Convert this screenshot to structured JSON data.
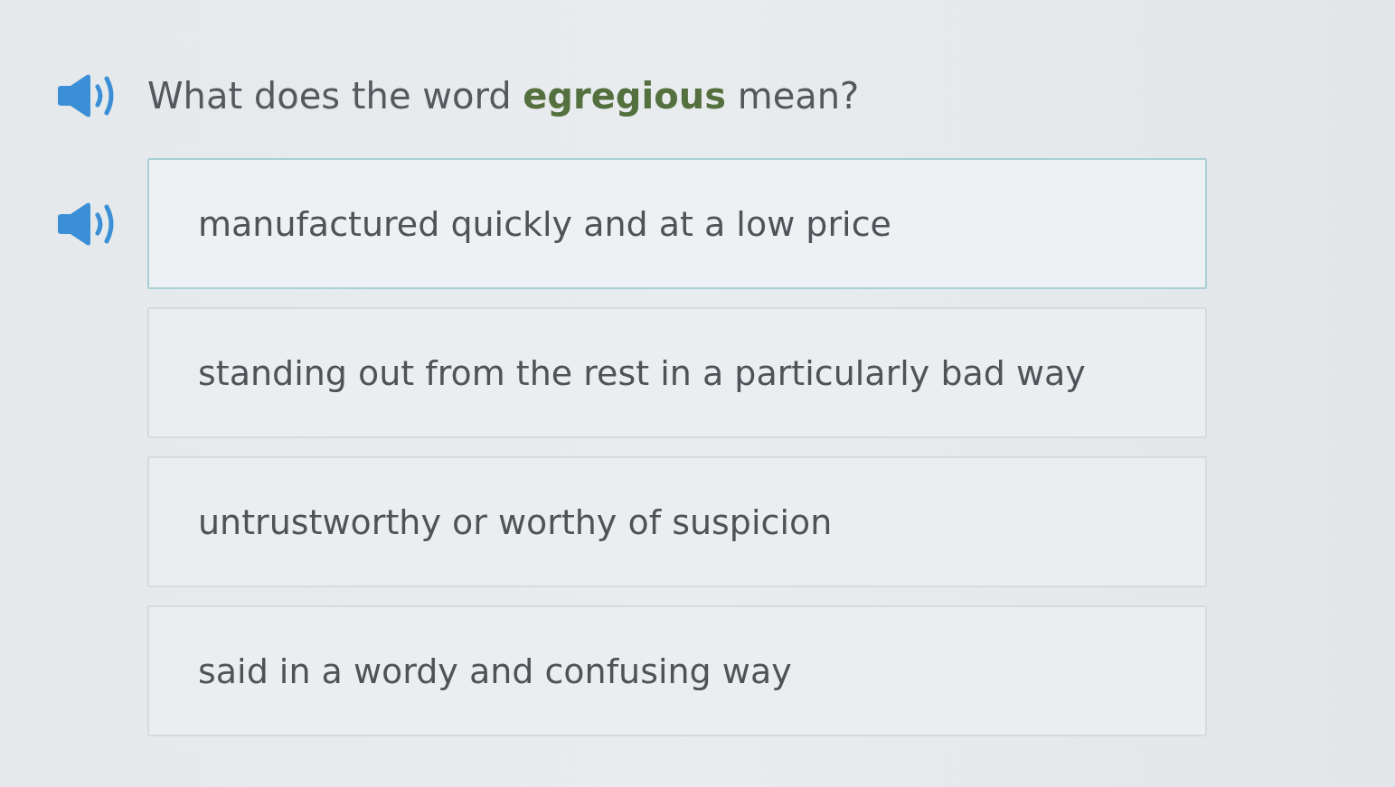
{
  "question": {
    "text": "What does the word **egregious** mean?",
    "audio": true
  },
  "options": [
    {
      "text": "manufactured quickly and at a low price",
      "hovered": true
    },
    {
      "text": "standing out from the rest in a particularly bad way",
      "hovered": false
    },
    {
      "text": "untrustworthy or worthy of suspicion",
      "hovered": false
    },
    {
      "text": "said in a wordy and confusing way",
      "hovered": false
    }
  ]
}
